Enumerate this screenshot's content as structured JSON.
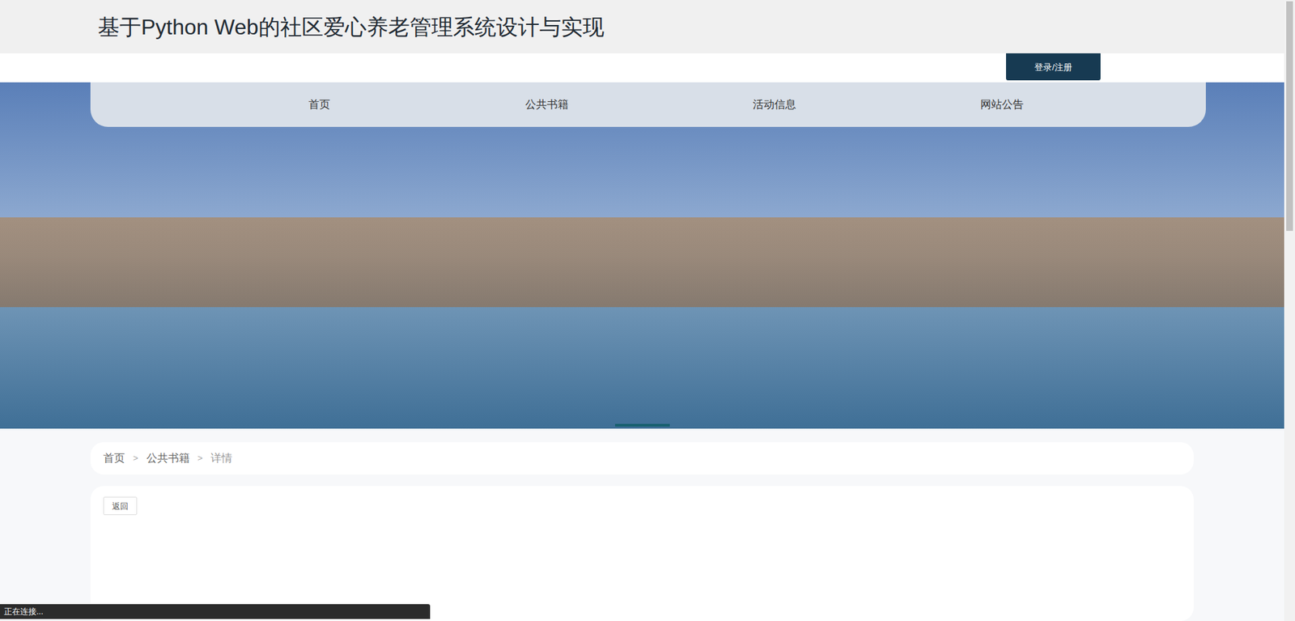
{
  "window": {
    "title": "基于Python Web的社区爱心养老管理系统设计与实现"
  },
  "header": {
    "login_button": "登录/注册"
  },
  "nav": {
    "items": [
      {
        "label": "首页",
        "selected": false
      },
      {
        "label": "公共书籍",
        "selected": false
      },
      {
        "label": "活动信息",
        "selected": false
      },
      {
        "label": "网站公告",
        "selected": false
      }
    ]
  },
  "carousel": {
    "slides": [
      {
        "selected": true
      }
    ]
  },
  "breadcrumb": {
    "items": [
      "首页",
      "公共书籍",
      "详情"
    ],
    "separator": ">"
  },
  "detail": {
    "back_button": "返回"
  },
  "status_bar": "正在连接..."
}
